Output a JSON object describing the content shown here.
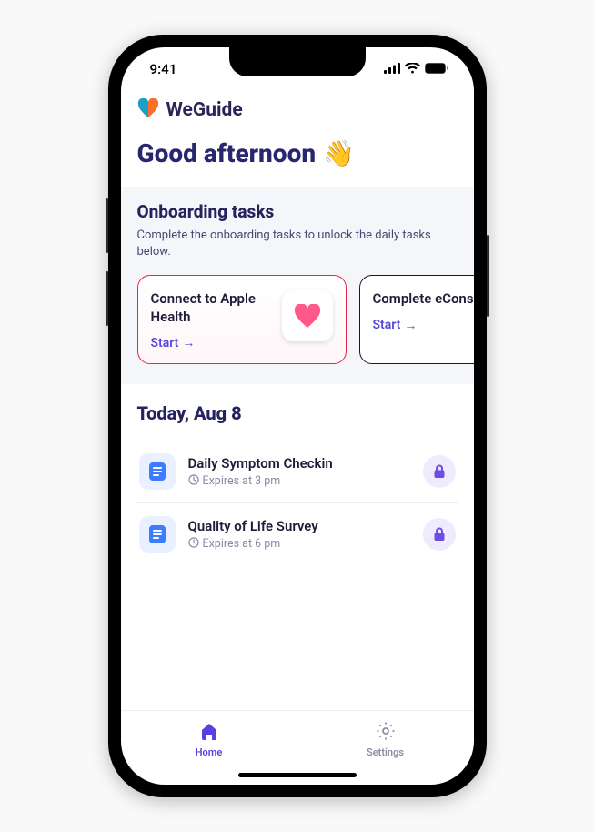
{
  "status": {
    "time": "9:41"
  },
  "brand": {
    "name": "WeGuide"
  },
  "greeting": "Good afternoon",
  "onboarding": {
    "title": "Onboarding tasks",
    "subtitle": "Complete the onboarding tasks to unlock the daily tasks below.",
    "cards": [
      {
        "title": "Connect to Apple Health",
        "action": "Start"
      },
      {
        "title": "Complete eConsent",
        "action": "Start"
      }
    ]
  },
  "today": {
    "title": "Today, Aug 8",
    "tasks": [
      {
        "title": "Daily Symptom Checkin",
        "expires": "Expires at 3 pm"
      },
      {
        "title": "Quality of Life Survey",
        "expires": "Expires at 6 pm"
      }
    ]
  },
  "tabs": {
    "home": "Home",
    "settings": "Settings"
  },
  "colors": {
    "primary": "#5a3fe0",
    "heading": "#27266f",
    "accent": "#e6244f"
  }
}
